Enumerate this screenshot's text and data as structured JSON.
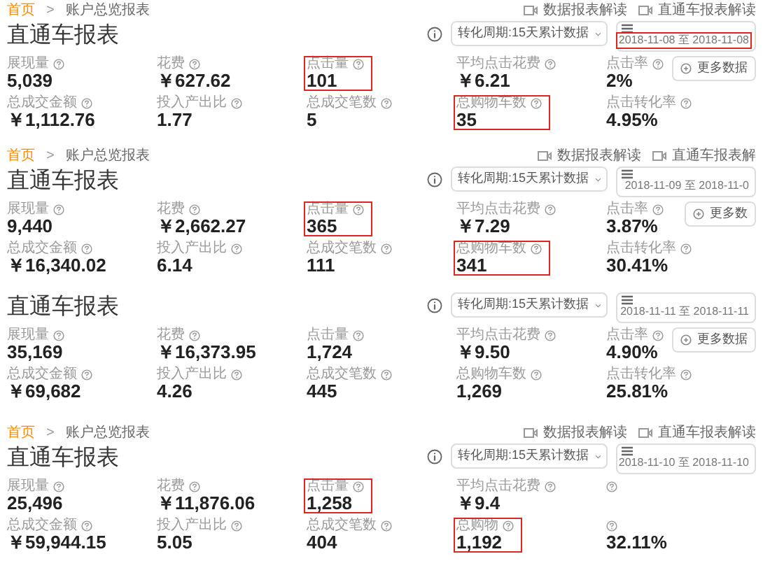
{
  "panels": [
    {
      "breadcrumb": {
        "home": "首页",
        "separator": ">",
        "current": "账户总览报表"
      },
      "header_links": [
        "数据报表解读",
        "直通车报表解读"
      ],
      "title": "直通车报表",
      "period_select": "转化周期:15天累计数据",
      "date_range": {
        "text": "2018-11-08 至 2018-11-08",
        "highlighted": true
      },
      "more_button": "更多数据",
      "metrics": [
        {
          "kind": "metric",
          "label": "展现量",
          "value": "5,039",
          "highlighted": false
        },
        {
          "kind": "metric",
          "label": "花费",
          "value": "￥627.62",
          "highlighted": false
        },
        {
          "kind": "metric",
          "label": "点击量",
          "value": "101",
          "highlighted": true
        },
        {
          "kind": "metric",
          "label": "平均点击花费",
          "value": "￥6.21",
          "highlighted": false
        },
        {
          "kind": "metric",
          "label": "点击率",
          "value": "2%",
          "highlighted": false
        },
        {
          "kind": "metric",
          "label": "总成交金额",
          "value": "￥1,112.76",
          "highlighted": false
        },
        {
          "kind": "metric",
          "label": "投入产出比",
          "value": "1.77",
          "highlighted": false
        },
        {
          "kind": "metric",
          "label": "总成交笔数",
          "value": "5",
          "highlighted": false
        },
        {
          "kind": "metric",
          "label": "总购物车数",
          "value": "35",
          "highlighted": true
        },
        {
          "kind": "metric",
          "label": "点击转化率",
          "value": "4.95%",
          "highlighted": false
        }
      ]
    },
    {
      "breadcrumb": {
        "home": "首页",
        "separator": ">",
        "current": "账户总览报表"
      },
      "header_links": [
        "数据报表解读",
        "直通车报表解"
      ],
      "title": "直通车报表",
      "period_select": "转化周期:15天累计数据",
      "date_range": {
        "text": "2018-11-09 至 2018-11-0",
        "highlighted": false
      },
      "more_button": "更多数",
      "metrics": [
        {
          "kind": "metric",
          "label": "展现量",
          "value": "9,440",
          "highlighted": false
        },
        {
          "kind": "metric",
          "label": "花费",
          "value": "￥2,662.27",
          "highlighted": false
        },
        {
          "kind": "metric",
          "label": "点击量",
          "value": "365",
          "highlighted": true
        },
        {
          "kind": "metric",
          "label": "平均点击花费",
          "value": "￥7.29",
          "highlighted": false
        },
        {
          "kind": "metric",
          "label": "点击率",
          "value": "3.87%",
          "highlighted": false
        },
        {
          "kind": "metric",
          "label": "总成交金额",
          "value": "￥16,340.02",
          "highlighted": false
        },
        {
          "kind": "metric",
          "label": "投入产出比",
          "value": "6.14",
          "highlighted": false
        },
        {
          "kind": "metric",
          "label": "总成交笔数",
          "value": "111",
          "highlighted": false
        },
        {
          "kind": "metric",
          "label": "总购物车数",
          "value": "341",
          "highlighted": true
        },
        {
          "kind": "metric",
          "label": "点击转化率",
          "value": "30.41%",
          "highlighted": false
        }
      ]
    },
    {
      "title": "直通车报表",
      "period_select": "转化周期:15天累计数据",
      "date_range": {
        "text": "2018-11-11 至 2018-11-11",
        "highlighted": false
      },
      "more_button": "更多数据",
      "metrics": [
        {
          "kind": "metric",
          "label": "展现量",
          "value": "35,169",
          "highlighted": false
        },
        {
          "kind": "metric",
          "label": "花费",
          "value": "￥16,373.95",
          "highlighted": false
        },
        {
          "kind": "metric",
          "label": "点击量",
          "value": "1,724",
          "highlighted": false
        },
        {
          "kind": "metric",
          "label": "平均点击花费",
          "value": "￥9.50",
          "highlighted": false
        },
        {
          "kind": "metric",
          "label": "点击率",
          "value": "4.90%",
          "highlighted": false
        },
        {
          "kind": "metric",
          "label": "总成交金额",
          "value": "￥69,682",
          "highlighted": false
        },
        {
          "kind": "metric",
          "label": "投入产出比",
          "value": "4.26",
          "highlighted": false
        },
        {
          "kind": "metric",
          "label": "总成交笔数",
          "value": "445",
          "highlighted": false
        },
        {
          "kind": "metric",
          "label": "总购物车数",
          "value": "1,269",
          "highlighted": false
        },
        {
          "kind": "metric",
          "label": "点击转化率",
          "value": "25.81%",
          "highlighted": false
        }
      ]
    },
    {
      "breadcrumb": {
        "home": "首页",
        "separator": ">",
        "current": "账户总览报表"
      },
      "header_links": [
        "数据报表解读",
        "直通车报表解读"
      ],
      "title": "直通车报表",
      "period_select": "转化周期:15天累计数据",
      "date_range": {
        "text": "2018-11-10 至 2018-11-10",
        "highlighted": false
      },
      "metrics": [
        {
          "kind": "metric",
          "label": "展现量",
          "value": "25,496",
          "highlighted": false
        },
        {
          "kind": "metric",
          "label": "花费",
          "value": "￥11,876.06",
          "highlighted": false
        },
        {
          "kind": "metric",
          "label": "点击量",
          "value": "1,258",
          "highlighted": true
        },
        {
          "kind": "metric",
          "label": "平均点击花费",
          "value": "￥9.4",
          "highlighted": false
        },
        {
          "kind": "help_only",
          "highlighted": false
        },
        {
          "kind": "metric",
          "label": "总成交金额",
          "value": "￥59,944.15",
          "highlighted": false
        },
        {
          "kind": "metric",
          "label": "投入产出比",
          "value": "5.05",
          "highlighted": false
        },
        {
          "kind": "metric",
          "label": "总成交笔数",
          "value": "404",
          "highlighted": false
        },
        {
          "kind": "metric",
          "label": "总购物",
          "value": "1,192",
          "highlighted": true
        },
        {
          "kind": "value_only",
          "value": "32.11%",
          "highlighted": false
        }
      ]
    }
  ]
}
